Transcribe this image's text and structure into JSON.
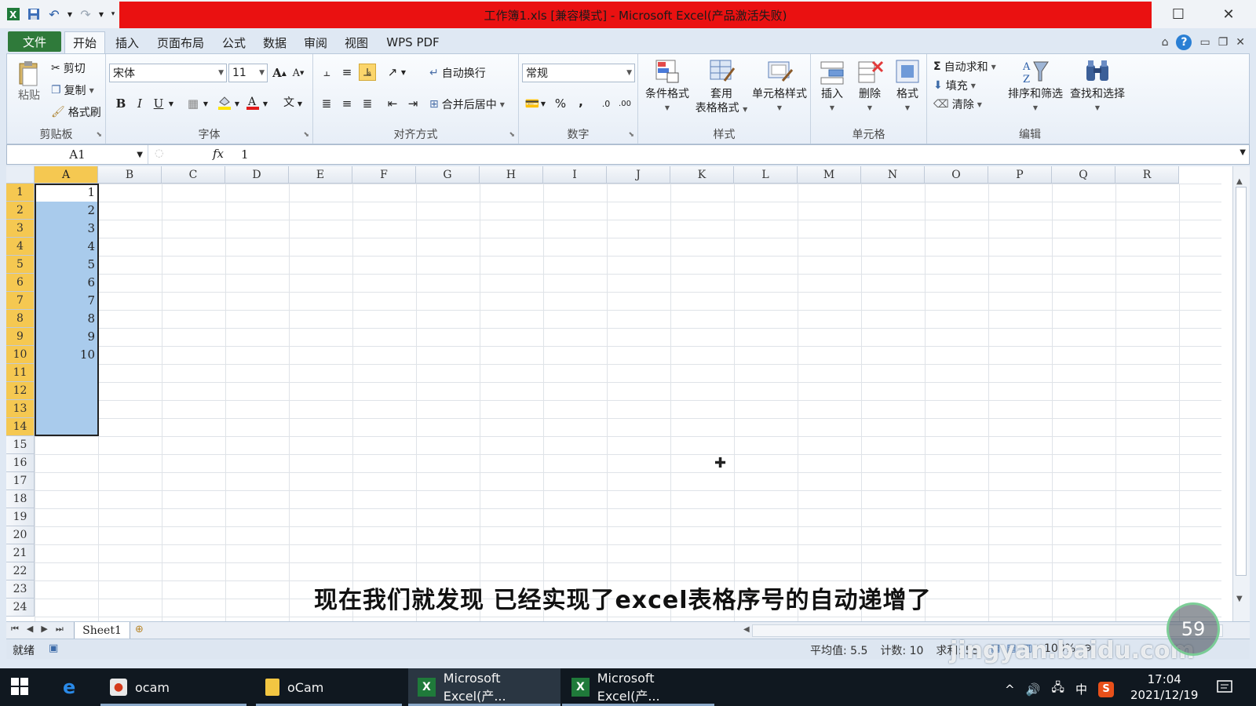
{
  "window": {
    "title": "工作簿1.xls  [兼容模式] - Microsoft Excel(产品激活失败)",
    "title_bar_color": "#ea1111"
  },
  "menu": {
    "file": "文件",
    "tabs": [
      "开始",
      "插入",
      "页面布局",
      "公式",
      "数据",
      "审阅",
      "视图",
      "WPS PDF"
    ],
    "active_tab": "开始"
  },
  "ribbon": {
    "clipboard": {
      "label": "剪贴板",
      "paste": "粘贴",
      "cut": "剪切",
      "copy": "复制",
      "format_painter": "格式刷"
    },
    "font": {
      "label": "字体",
      "font_name": "宋体",
      "font_size": "11",
      "bold": "B",
      "italic": "I",
      "underline": "U",
      "grow": "A",
      "shrink": "A",
      "phonetic": "文"
    },
    "alignment": {
      "label": "对齐方式",
      "wrap": "自动换行",
      "merge": "合并后居中"
    },
    "number": {
      "label": "数字",
      "format": "常规",
      "percent": "%",
      "comma": ",",
      "inc_dec": ".0",
      "dec_dec": ".00"
    },
    "styles": {
      "label": "样式",
      "conditional": "条件格式",
      "table_1": "套用",
      "table_2": "表格格式",
      "cell_styles": "单元格样式"
    },
    "cells": {
      "label": "单元格",
      "insert": "插入",
      "delete": "删除",
      "format": "格式"
    },
    "editing": {
      "label": "编辑",
      "autosum": "自动求和",
      "fill": "填充",
      "clear": "清除",
      "sort_filter": "排序和筛选",
      "find_select": "查找和选择",
      "sigma": "Σ"
    }
  },
  "formula_bar": {
    "name_box": "A1",
    "fx": "fx",
    "value": "1"
  },
  "grid": {
    "columns": [
      "A",
      "B",
      "C",
      "D",
      "E",
      "F",
      "G",
      "H",
      "I",
      "J",
      "K",
      "L",
      "M",
      "N",
      "O",
      "P",
      "Q",
      "R"
    ],
    "rows": [
      "1",
      "2",
      "3",
      "4",
      "5",
      "6",
      "7",
      "8",
      "9",
      "10",
      "11",
      "12",
      "13",
      "14",
      "15",
      "16",
      "17",
      "18",
      "19",
      "20",
      "21",
      "22",
      "23",
      "24"
    ],
    "column_a_values": [
      "1",
      "2",
      "3",
      "4",
      "5",
      "6",
      "7",
      "8",
      "9",
      "10"
    ],
    "selected_column": "A",
    "selected_rows": [
      "1",
      "2",
      "3",
      "4",
      "5",
      "6",
      "7",
      "8",
      "9",
      "10",
      "11",
      "12",
      "13",
      "14"
    ],
    "selection_color": "#a9cbec",
    "header_highlight_color": "#f5c851"
  },
  "subtitle": "现在我们就发现 已经实现了excel表格序号的自动递增了",
  "sheets": {
    "tabs": [
      "Sheet1"
    ]
  },
  "status": {
    "ready": "就绪",
    "average": "平均值: 5.5",
    "count": "计数: 10",
    "sum": "求和: 55",
    "zoom": "100%"
  },
  "watermark": {
    "text": "jingyan.baidu.com",
    "badge": "59"
  },
  "taskbar": {
    "items": [
      "ocam",
      "oCam",
      "Microsoft Excel(产...",
      "Microsoft Excel(产..."
    ],
    "ime": "中",
    "time": "17:04",
    "date": "2021/12/19"
  }
}
